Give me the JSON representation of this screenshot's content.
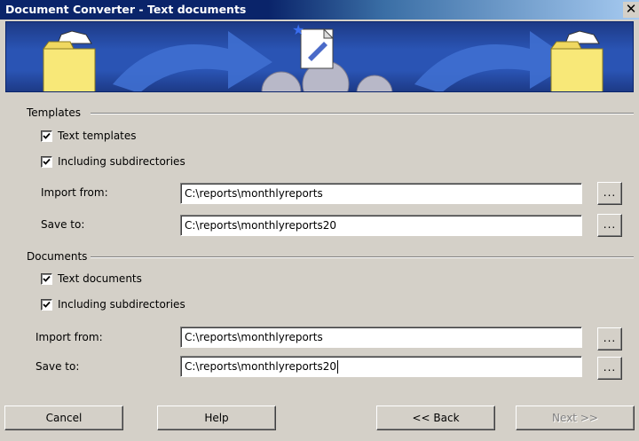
{
  "window": {
    "title": "Document Converter - Text documents",
    "close_glyph": "✕"
  },
  "banner": {
    "icons": [
      "folder-document-icon",
      "arrow-icon",
      "document-convert-gears-icon",
      "arrow-icon",
      "folder-document-icon"
    ]
  },
  "templates": {
    "group_label": "Templates",
    "checkbox_text": {
      "label": "Text templates",
      "checked": true
    },
    "checkbox_subdirs": {
      "label": "Including subdirectories",
      "checked": true
    },
    "import_label": "Import from:",
    "import_value": "C:\\reports\\monthlyreports",
    "save_label": "Save to:",
    "save_value": "C:\\reports\\monthlyreports20",
    "browse_label": "..."
  },
  "documents": {
    "group_label": "Documents",
    "checkbox_text": {
      "label": "Text documents",
      "checked": true
    },
    "checkbox_subdirs": {
      "label": "Including subdirectories",
      "checked": true
    },
    "import_label": "Import from:",
    "import_value": "C:\\reports\\monthlyreports",
    "save_label": "Save to:",
    "save_value": "C:\\reports\\monthlyreports20",
    "browse_label": "..."
  },
  "buttons": {
    "cancel": "Cancel",
    "help": "Help",
    "back": "<< Back",
    "next": "Next >>",
    "next_enabled": false
  },
  "colors": {
    "titlebar_start": "#0a246a",
    "titlebar_end": "#a6caf0",
    "banner_blue": "#2a54b4",
    "dialog_bg": "#d4d0c8"
  }
}
